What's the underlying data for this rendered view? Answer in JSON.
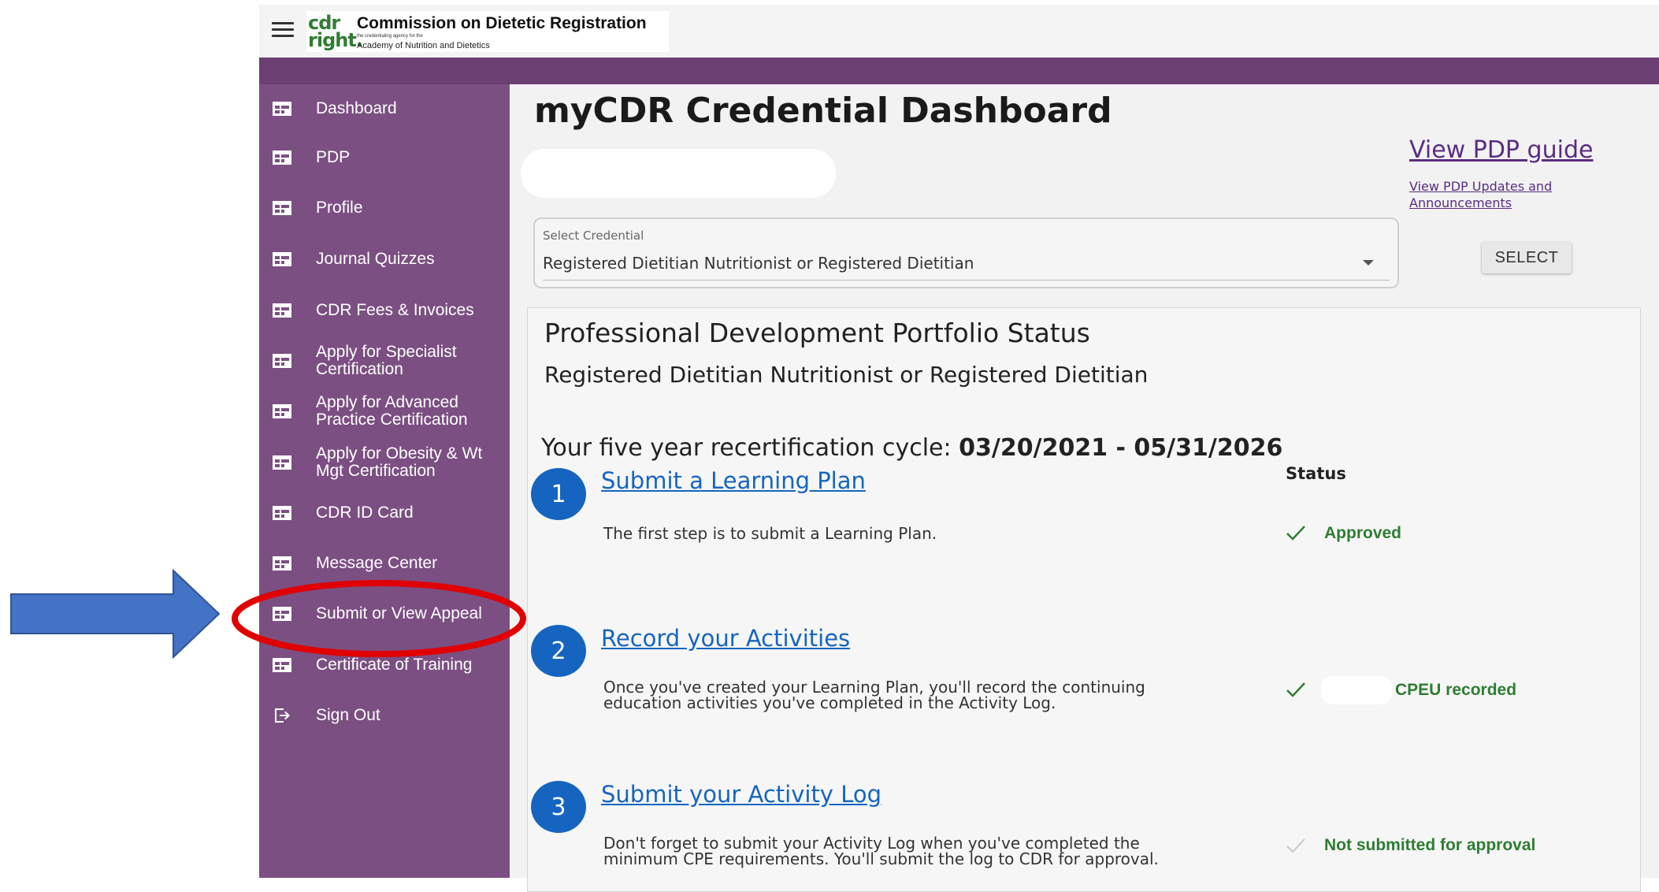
{
  "header": {
    "logo_mark": "cdr\nright.",
    "org_name": "Commission on Dietetic Registration",
    "org_tagline": "the credentialing agency for the",
    "org_sub": "Academy of Nutrition and Dietetics"
  },
  "sidebar": {
    "items": [
      {
        "label": "Dashboard",
        "icon": "dashboard-icon"
      },
      {
        "label": "PDP",
        "icon": "dashboard-icon"
      },
      {
        "label": "Profile",
        "icon": "dashboard-icon"
      },
      {
        "label": "Journal Quizzes",
        "icon": "dashboard-icon"
      },
      {
        "label": "CDR Fees & Invoices",
        "icon": "dashboard-icon"
      },
      {
        "label": "Apply for Specialist\nCertification",
        "icon": "dashboard-icon"
      },
      {
        "label": "Apply for Advanced\nPractice Certification",
        "icon": "dashboard-icon"
      },
      {
        "label": "Apply for Obesity & Wt\nMgt Certification",
        "icon": "dashboard-icon"
      },
      {
        "label": "CDR ID Card",
        "icon": "dashboard-icon"
      },
      {
        "label": "Message Center",
        "icon": "dashboard-icon"
      },
      {
        "label": "Submit or View Appeal",
        "icon": "dashboard-icon"
      },
      {
        "label": "Certificate of Training",
        "icon": "dashboard-icon"
      },
      {
        "label": "Sign Out",
        "icon": "sign-out-icon"
      }
    ]
  },
  "main": {
    "title": "myCDR Credential Dashboard",
    "view_guide_link": "View PDP guide",
    "updates_link": "View PDP Updates and Announcements",
    "select": {
      "label": "Select Credential",
      "value": "Registered Dietitian Nutritionist or Registered Dietitian"
    },
    "select_button": "SELECT"
  },
  "portfolio": {
    "title": "Professional Development Portfolio Status",
    "credential": "Registered Dietitian Nutritionist or Registered Dietitian",
    "cycle_label": "Your five year recertification cycle:",
    "cycle_dates": "03/20/2021 - 05/31/2026",
    "status_header": "Status",
    "steps": [
      {
        "number": "1",
        "title": "Submit a Learning Plan",
        "description": "The first step is to submit a Learning Plan.",
        "status": "Approved"
      },
      {
        "number": "2",
        "title": "Record your Activities",
        "description": "Once you've created your Learning Plan, you'll record the continuing\neducation activities you've completed in the Activity Log.",
        "status": "CPEU recorded"
      },
      {
        "number": "3",
        "title": "Submit your Activity Log",
        "description": "Don't forget to submit your Activity Log when you've completed the\nminimum CPE requirements.  You'll submit the log to CDR for approval.",
        "status": "Not submitted for approval"
      }
    ]
  },
  "colors": {
    "sidebar": "#7b4f82",
    "banner": "#6b3f72",
    "link": "#1565c0",
    "status_green": "#2e7d32",
    "annotation_arrow": "#4472c4",
    "annotation_ellipse": "#e00000"
  }
}
